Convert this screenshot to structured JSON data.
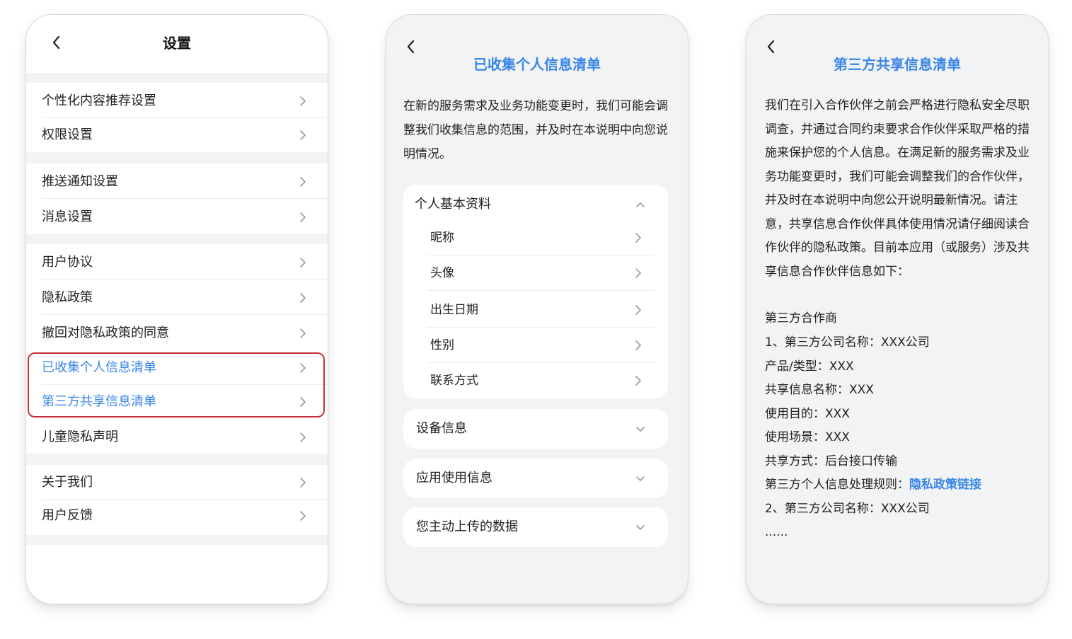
{
  "settings": {
    "title": "设置",
    "groups": [
      [
        "个性化内容推荐设置",
        "权限设置"
      ],
      [
        "推送通知设置",
        "消息设置"
      ],
      [
        "用户协议",
        "隐私政策",
        "撤回对隐私政策的同意",
        "已收集个人信息清单",
        "第三方共享信息清单",
        "儿童隐私声明"
      ],
      [
        "关于我们",
        "用户反馈"
      ]
    ]
  },
  "collected": {
    "title": "已收集个人信息清单",
    "intro": "在新的服务需求及业务功能变更时，我们可能会调整我们收集信息的范围，并及时在本说明中向您说明情况。",
    "basic_section": "个人基本资料",
    "basic_items": [
      "昵称",
      "头像",
      "出生日期",
      "性别",
      "联系方式"
    ],
    "sections": [
      "设备信息",
      "应用使用信息",
      "您主动上传的数据"
    ]
  },
  "shared": {
    "title": "第三方共享信息清单",
    "paragraph": "我们在引入合作伙伴之前会严格进行隐私安全尽职调查，并通过合同约束要求合作伙伴采取严格的措施来保护您的个人信息。在满足新的服务需求及业务功能变更时，我们可能会调整我们的合作伙伴，并及时在本说明中向您公开说明最新情况。请注意，共享信息合作伙伴具体使用情况请仔细阅读合作伙伴的隐私政策。目前本应用（或服务）涉及共享信息合作伙伴信息如下：",
    "partner_type": "第三方合作商",
    "company1": "1、第三方公司名称：XXX公司",
    "product": "产品/类型：XXX",
    "info_name": "共享信息名称：XXX",
    "purpose": "使用目的：XXX",
    "scene": "使用场景：XXX",
    "method": "共享方式：后台接口传输",
    "rule_label": "第三方个人信息处理规则：",
    "rule_link": "隐私政策链接",
    "company2": "2、第三方公司名称：XXX公司",
    "ellipsis": "......"
  },
  "colors": {
    "accent": "#3a86e8",
    "highlight": "#c8303b",
    "background": "#f2f3f5"
  },
  "icons": {
    "back": "chevron-left-icon",
    "forward": "chevron-right-icon",
    "expand": "chevron-down-icon",
    "collapse": "chevron-up-icon"
  }
}
